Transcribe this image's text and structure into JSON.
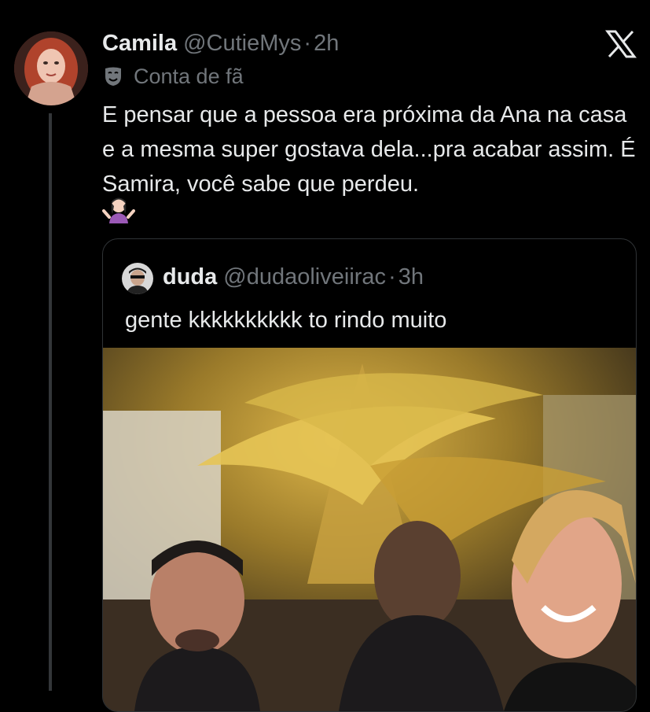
{
  "post": {
    "author_name": "Camila",
    "author_handle": "@CutieMys",
    "separator": "·",
    "time": "2h",
    "badge_label": "Conta de fã",
    "text": "E pensar que a pessoa era próxima da Ana na casa e a mesma super gostava dela...pra acabar assim. É Samira, você sabe que perdeu.",
    "emoji_name": "person-shrugging-emoji"
  },
  "quote": {
    "author_name": "duda",
    "author_handle": "@dudaoliveiirac",
    "separator": "·",
    "time": "3h",
    "text": "gente kkkkkkkkkk to rindo muito",
    "media": "video-frame"
  },
  "colors": {
    "background": "#000000",
    "text_primary": "#e7e9ea",
    "text_secondary": "#71767b",
    "border": "#2f3336"
  },
  "icons": {
    "close": "x-logo-icon",
    "badge": "theater-mask-icon"
  }
}
